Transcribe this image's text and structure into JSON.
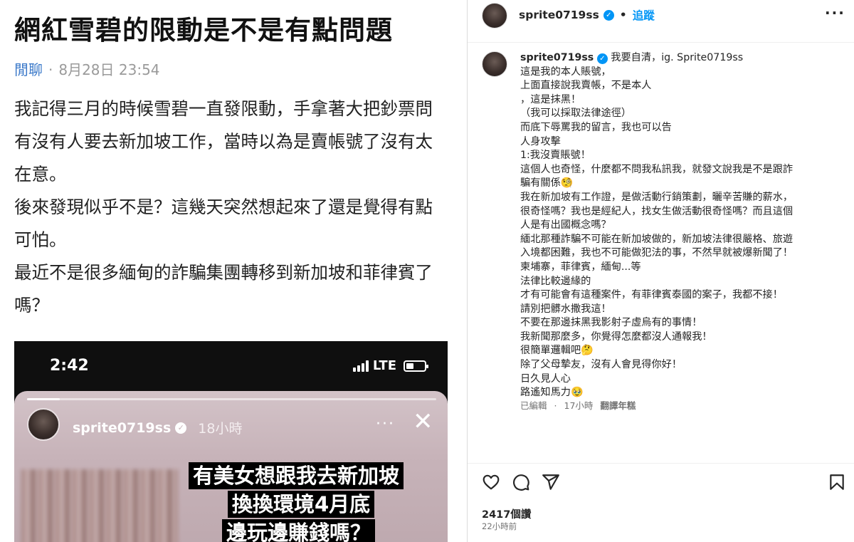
{
  "left": {
    "title": "網紅雪碧的限動是不是有點問題",
    "category": "閒聊",
    "separator": "·",
    "timestamp": "8月28日 23:54",
    "paragraphs": [
      "我記得三月的時候雪碧一直發限動，手拿著大把鈔票問有沒有人要去新加坡工作，當時以為是賣帳號了沒有太在意。",
      "後來發現似乎不是？這幾天突然想起來了還是覺得有點可怕。",
      "最近不是很多緬甸的詐騙集團轉移到新加坡和菲律賓了嗎？"
    ],
    "story": {
      "status_time": "2:42",
      "network": "LTE",
      "username": "sprite0719ss",
      "posted": "18小時",
      "more": "···",
      "close": "✕",
      "caption_lines": [
        "有美女想跟我去新加坡",
        "換換環境4月底",
        "邊玩邊賺錢嗎？"
      ]
    }
  },
  "right": {
    "header": {
      "username": "sprite0719ss",
      "verified": "✓",
      "dot": "•",
      "follow_label": "追蹤",
      "more": "···"
    },
    "caption": {
      "username": "sprite0719ss",
      "lines": [
        "我要自清，ig. Sprite0719ss",
        "這是我的本人賬號，",
        "上面直接說我賣帳，不是本人",
        "，這是抹黑！",
        "（我可以採取法律途徑）",
        "而底下辱罵我的留言，我也可以告",
        "人身攻擊",
        "1:我沒賣賬號！",
        "這個人也奇怪，什麼都不問我私訊我，就發文說我是不是跟詐",
        "騙有關係🧐",
        "我在新加坡有工作證，是做活動行銷策劃，曬辛苦賺的薪水，",
        "很奇怪嗎？我也是經紀人，找女生做活動很奇怪嗎？而且這個",
        "人是有出國概念嗎？",
        "緬北那種詐騙不可能在新加坡做的，新加坡法律很嚴格、旅遊",
        "入境都困難，我也不可能做犯法的事，不然早就被爆新聞了！",
        "柬埔寨，菲律賓，緬甸...等",
        "法律比較邊緣的",
        "才有可能會有這種案件，有菲律賓泰國的案子，我都不接！",
        "請別把髒水撒我這！",
        "不要在那邊抹黑我影射子虛烏有的事情！",
        "我新聞那麼多，你覺得怎麼都沒人通報我！",
        "很簡單邏輯吧🤔",
        "除了父母摯友，沒有人會見得你好！",
        "日久見人心",
        "路遙知馬力🥹"
      ],
      "edited": "已編輯",
      "dot": "·",
      "age": "17小時",
      "translate": "翻譯年糕"
    },
    "likes": "2417個讚",
    "posted_ago": "22小時前"
  }
}
